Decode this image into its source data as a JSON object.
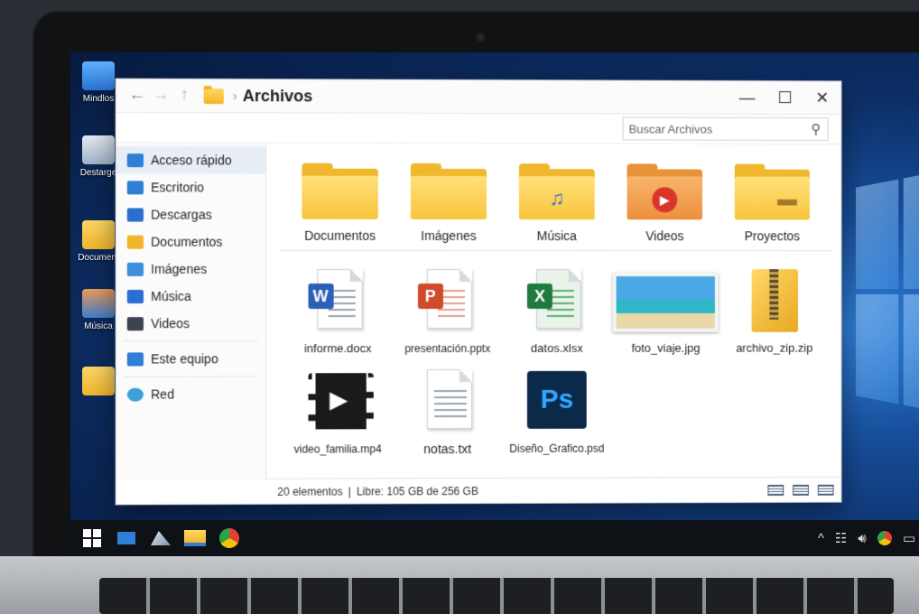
{
  "window": {
    "title": "Archivos",
    "search_placeholder": "Buscar Archivos",
    "controls": {
      "minimize": "—",
      "maximize": "☐",
      "close": "✕"
    }
  },
  "nav": {
    "back": "←",
    "forward": "→",
    "up": "↑",
    "separator": "›"
  },
  "sidebar": {
    "items": [
      {
        "label": "Acceso rápido",
        "icon": "quick-access-icon",
        "color": "#2f7fd6"
      },
      {
        "label": "Escritorio",
        "icon": "desktop-icon",
        "color": "#2f7fd6"
      },
      {
        "label": "Descargas",
        "icon": "download-icon",
        "color": "#2d6fd0"
      },
      {
        "label": "Documentos",
        "icon": "documents-icon",
        "color": "#f2b62a"
      },
      {
        "label": "Imágenes",
        "icon": "pictures-icon",
        "color": "#3c8fdc"
      },
      {
        "label": "Música",
        "icon": "music-icon",
        "color": "#2d6fd0"
      },
      {
        "label": "Videos",
        "icon": "videos-icon",
        "color": "#3c4452"
      },
      {
        "label": "Este equipo",
        "icon": "computer-icon",
        "color": "#2f7fd6"
      },
      {
        "label": "Red",
        "icon": "network-icon",
        "color": "#3aa2d6"
      }
    ]
  },
  "folders": [
    {
      "label": "Documentos",
      "badge": ""
    },
    {
      "label": "Imágenes",
      "badge": ""
    },
    {
      "label": "Música",
      "badge": "♫"
    },
    {
      "label": "Videos",
      "badge": "▶"
    },
    {
      "label": "Proyectos",
      "badge": "▬"
    }
  ],
  "files": [
    {
      "label": "informe.docx",
      "type": "word",
      "badge": "W",
      "color": "#2b5fb8"
    },
    {
      "label": "presentación.pptx",
      "type": "powerpoint",
      "badge": "P",
      "color": "#d04a2c"
    },
    {
      "label": "datos.xlsx",
      "type": "excel",
      "badge": "X",
      "color": "#1f7a3f"
    },
    {
      "label": "foto_viaje.jpg",
      "type": "image",
      "badge": "",
      "color": "#3c9bd6"
    },
    {
      "label": "archivo_zip.zip",
      "type": "zip",
      "badge": "",
      "color": "#f2b62a"
    },
    {
      "label": "video_familia.mp4",
      "type": "video",
      "badge": "▶",
      "color": "#1a1a1a"
    },
    {
      "label": "notas.txt",
      "type": "text",
      "badge": "",
      "color": "#9aa3ad"
    },
    {
      "label": "Diseño_Grafico.psd",
      "type": "photoshop",
      "badge": "Ps",
      "color": "#0b2a4a"
    }
  ],
  "status": {
    "count": "20 elementos",
    "separator": "|",
    "free": "Libre: 105 GB de 256 GB"
  },
  "desktop_icons": [
    {
      "label": "Mindlos"
    },
    {
      "label": "Destarge"
    },
    {
      "label": "Document"
    },
    {
      "label": "Música"
    },
    {
      "label": ""
    }
  ]
}
